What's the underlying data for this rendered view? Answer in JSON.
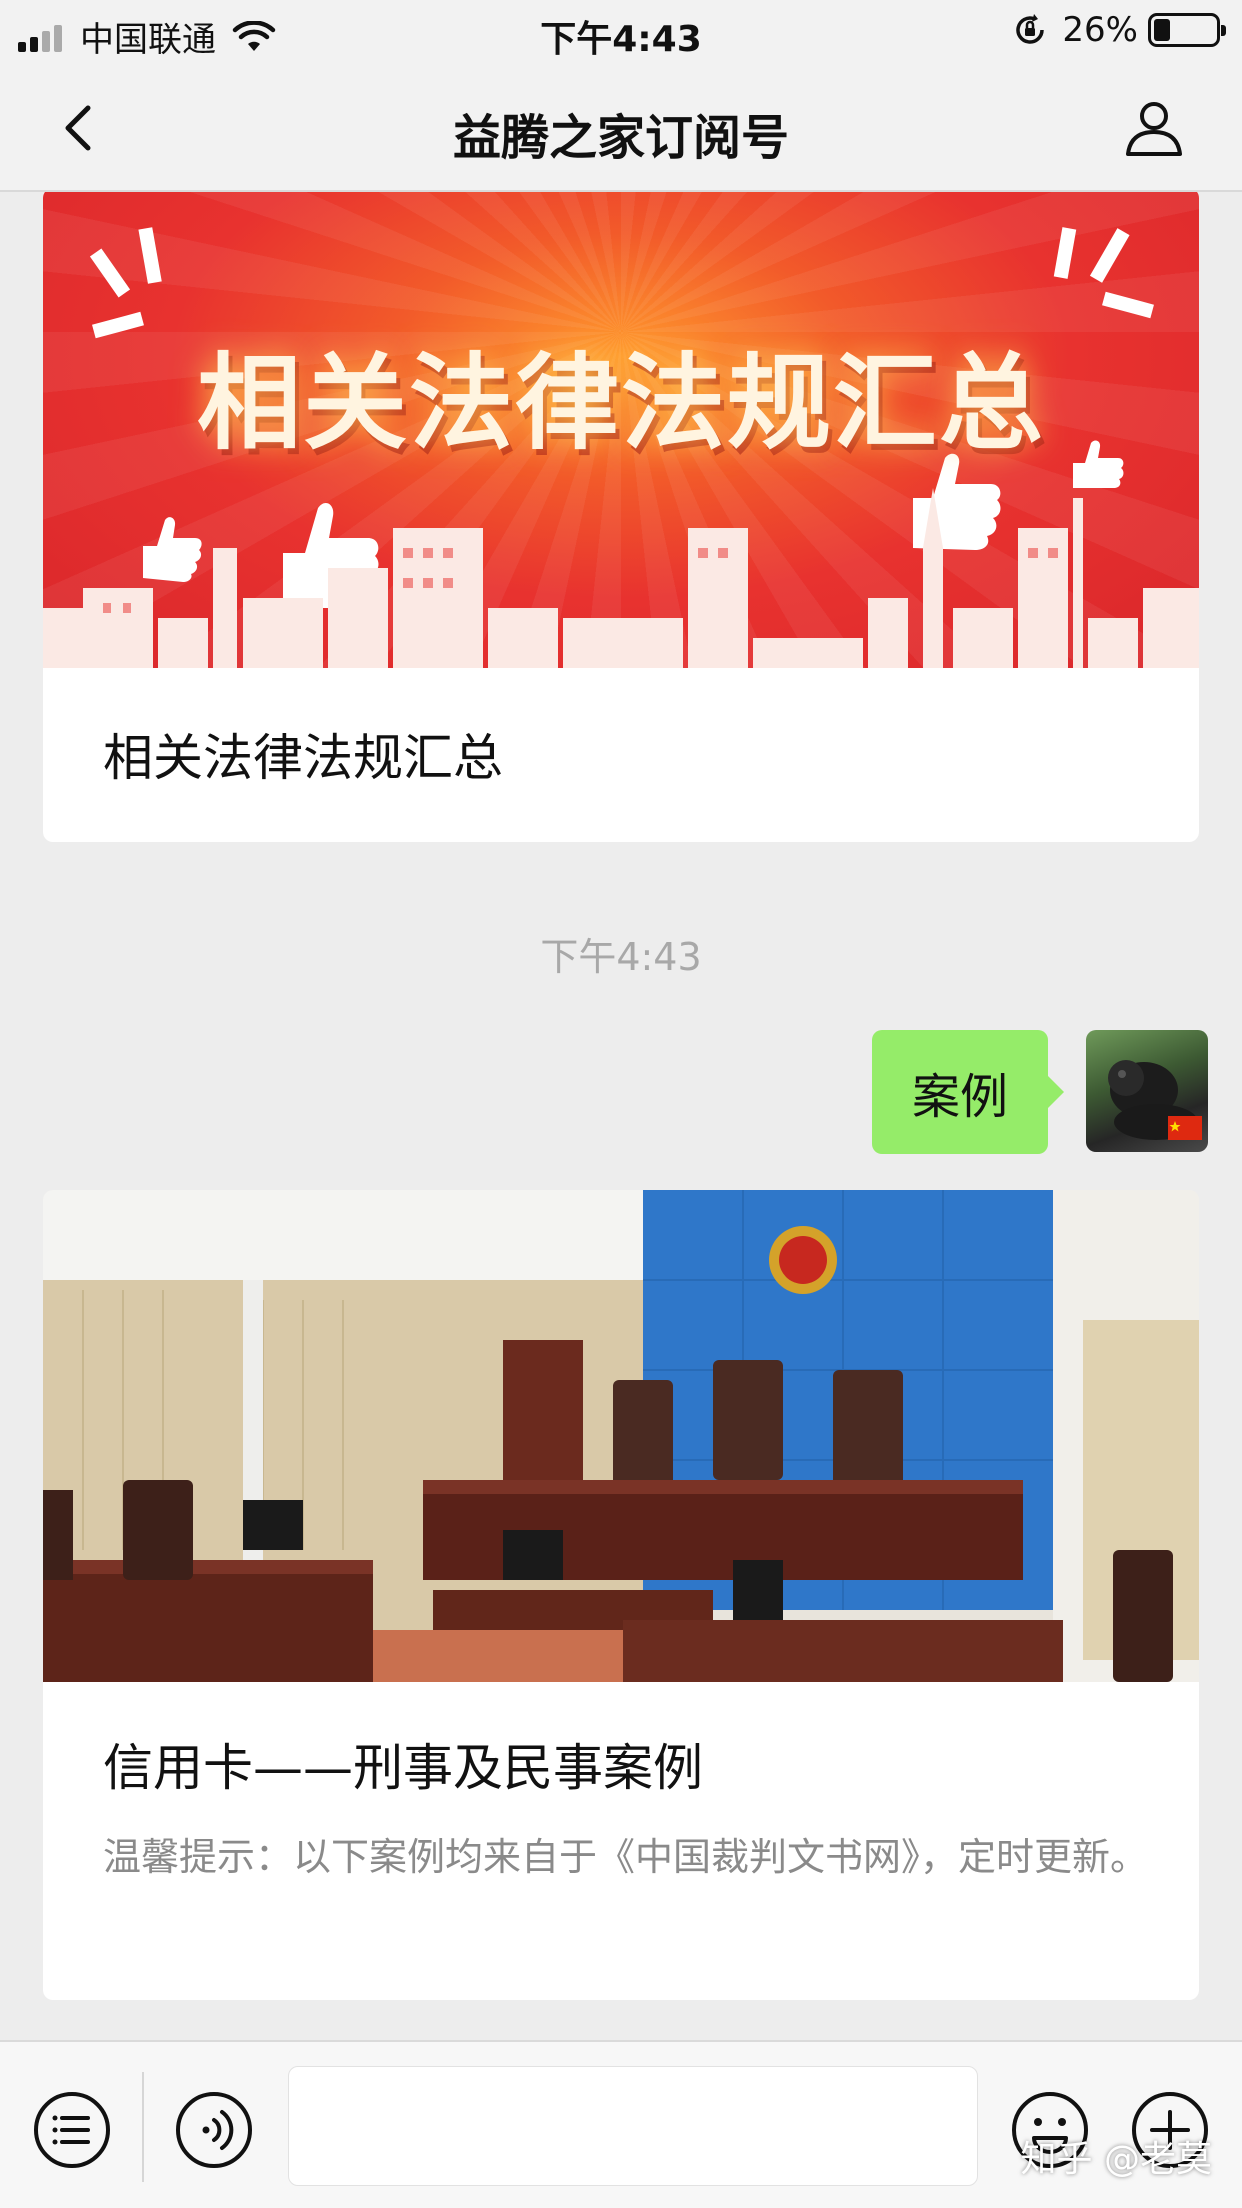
{
  "status_bar": {
    "carrier": "中国联通",
    "time": "下午4:43",
    "battery_percent": "26%",
    "battery_level": 0.26,
    "icons": [
      "signal-icon",
      "wifi-icon",
      "rotation-lock-icon",
      "battery-icon"
    ]
  },
  "nav": {
    "title": "益腾之家订阅号",
    "icons": [
      "back-icon",
      "profile-icon"
    ]
  },
  "messages": {
    "article1": {
      "banner_text": "相关法律法规汇总",
      "title": "相关法律法规汇总"
    },
    "timestamp": "下午4:43",
    "sent_message": "案例",
    "article2": {
      "title": "信用卡——刑事及民事案例",
      "description": "温馨提示：以下案例均来自于《中国裁判文书网》，定时更新。"
    }
  },
  "input_bar": {
    "icons": [
      "menu-icon",
      "voice-icon",
      "emoji-icon",
      "plus-icon"
    ]
  },
  "watermark": "知乎 @老莫",
  "colors": {
    "bubble": "#95ec69",
    "background": "#ededed",
    "banner_red": "#e8322f"
  }
}
